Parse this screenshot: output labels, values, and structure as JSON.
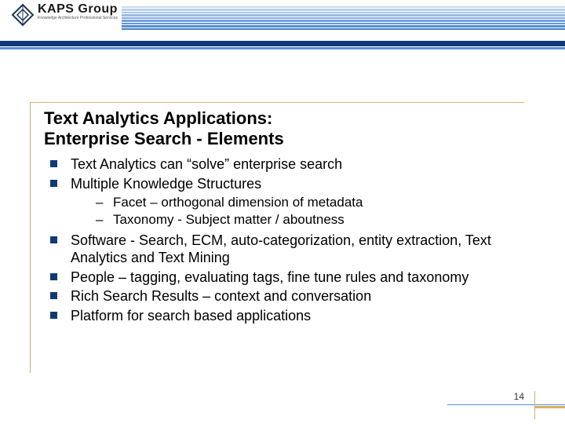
{
  "logo": {
    "name": "KAPS Group",
    "tagline": "Knowledge Architecture Professional Services"
  },
  "title_line1": "Text Analytics Applications:",
  "title_line2": "Enterprise Search - Elements",
  "bullets": {
    "b1": "Text Analytics can “solve” enterprise search",
    "b2": "Multiple Knowledge Structures",
    "b2_sub1": "Facet – orthogonal dimension of metadata",
    "b2_sub2": "Taxonomy  - Subject matter / aboutness",
    "b3": "Software  - Search, ECM, auto-categorization, entity extraction, Text Analytics and Text Mining",
    "b4": "People – tagging, evaluating tags, fine tune rules and taxonomy",
    "b5": "Rich Search Results – context and conversation",
    "b6": "Platform for search based applications"
  },
  "page_number": "14",
  "stripe_colors": [
    "#c9dbf2",
    "#b9d0ee",
    "#a9c5ea",
    "#98bae6",
    "#87aee1",
    "#76a3dd",
    "#6597d8",
    "#548cd4",
    "#4280cf",
    "#3175cb"
  ]
}
